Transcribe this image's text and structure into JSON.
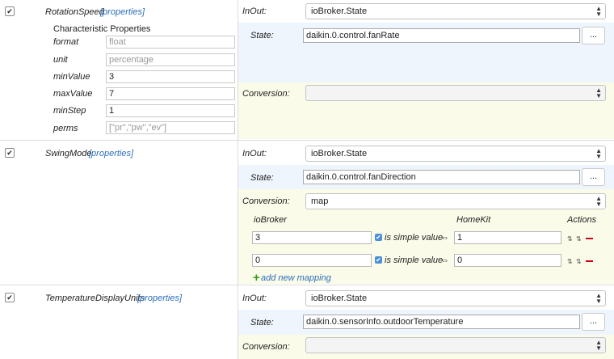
{
  "rows": [
    {
      "name": "RotationSpeed",
      "properties_link": "[properties]",
      "characteristic_title": "Characteristic Properties",
      "props": [
        {
          "label": "format",
          "value": "float",
          "readonly": true
        },
        {
          "label": "unit",
          "value": "percentage",
          "readonly": true
        },
        {
          "label": "minValue",
          "value": "3",
          "readonly": false
        },
        {
          "label": "maxValue",
          "value": "7",
          "readonly": false
        },
        {
          "label": "minStep",
          "value": "1",
          "readonly": false
        },
        {
          "label": "perms",
          "value": "[\"pr\",\"pw\",\"ev\"]",
          "readonly": true
        }
      ],
      "inout_label": "InOut:",
      "inout_value": "ioBroker.State",
      "state_label": "State:",
      "state_value": "daikin.0.control.fanRate",
      "browse_label": "...",
      "conversion_label": "Conversion:",
      "conversion_value": ""
    },
    {
      "name": "SwingMode",
      "properties_link": "[properties]",
      "inout_label": "InOut:",
      "inout_value": "ioBroker.State",
      "state_label": "State:",
      "state_value": "daikin.0.control.fanDirection",
      "browse_label": "...",
      "conversion_label": "Conversion:",
      "conversion_value": "map",
      "mapping": {
        "col_iobroker": "ioBroker",
        "col_homekit": "HomeKit",
        "col_actions": "Actions",
        "simple_label": "is simple value",
        "arrow": "⇔",
        "entries": [
          {
            "iobroker": "3",
            "homekit": "1"
          },
          {
            "iobroker": "0",
            "homekit": "0"
          }
        ],
        "add_label": "add new mapping"
      }
    },
    {
      "name": "TemperatureDisplayUnits",
      "properties_link": "[properties]",
      "inout_label": "InOut:",
      "inout_value": "ioBroker.State",
      "state_label": "State:",
      "state_value": "daikin.0.sensorInfo.outdoorTemperature",
      "browse_label": "...",
      "conversion_label": "Conversion:",
      "conversion_value": ""
    }
  ]
}
